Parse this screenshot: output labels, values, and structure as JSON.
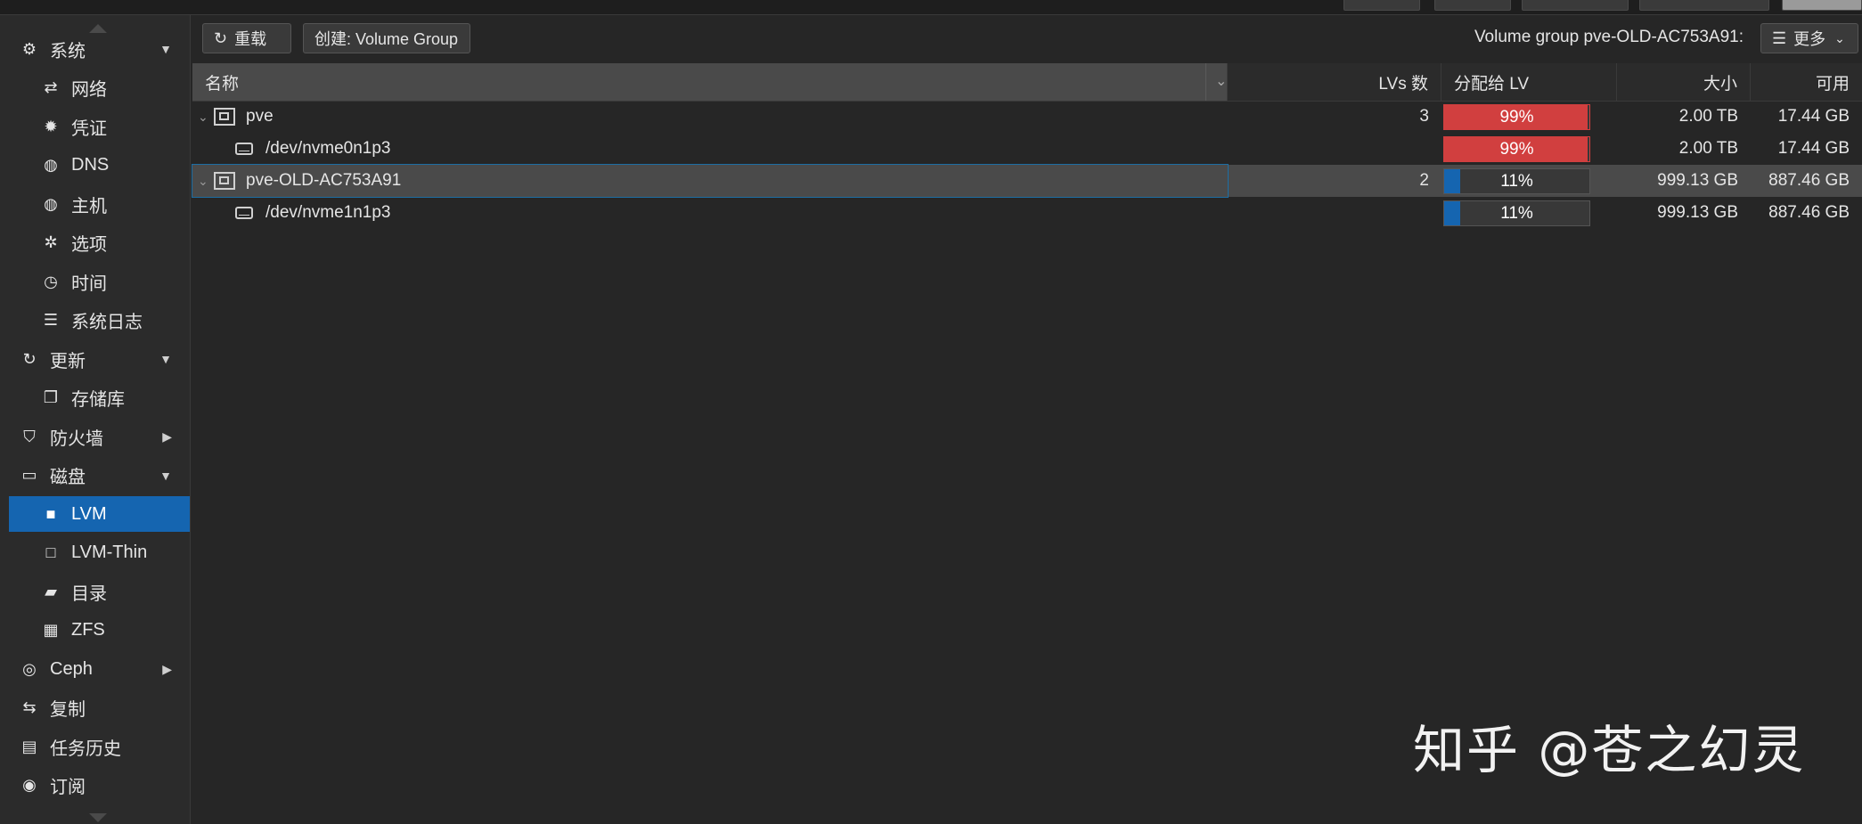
{
  "sidebar": {
    "items": [
      {
        "label": "系统",
        "icon": "gears-icon",
        "glyph": "⚙",
        "level": "top",
        "arrow": "▼"
      },
      {
        "label": "网络",
        "icon": "exchange-icon",
        "glyph": "⇄",
        "level": "sub"
      },
      {
        "label": "凭证",
        "icon": "certificate-icon",
        "glyph": "✹",
        "level": "sub"
      },
      {
        "label": "DNS",
        "icon": "globe-icon",
        "glyph": "◍",
        "level": "sub"
      },
      {
        "label": "主机",
        "icon": "globe-icon",
        "glyph": "◍",
        "level": "sub"
      },
      {
        "label": "选项",
        "icon": "gear-icon",
        "glyph": "✲",
        "level": "sub"
      },
      {
        "label": "时间",
        "icon": "clock-icon",
        "glyph": "◷",
        "level": "sub"
      },
      {
        "label": "系统日志",
        "icon": "list-icon",
        "glyph": "☰",
        "level": "sub"
      },
      {
        "label": "更新",
        "icon": "refresh-icon",
        "glyph": "↻",
        "level": "top",
        "arrow": "▼"
      },
      {
        "label": "存储库",
        "icon": "copy-icon",
        "glyph": "❐",
        "level": "sub"
      },
      {
        "label": "防火墙",
        "icon": "shield-icon",
        "glyph": "⛉",
        "level": "top",
        "arrow": "▶"
      },
      {
        "label": "磁盘",
        "icon": "hdd-icon",
        "glyph": "▭",
        "level": "top",
        "arrow": "▼"
      },
      {
        "label": "LVM",
        "icon": "square-icon",
        "glyph": "■",
        "level": "sub",
        "selected": true
      },
      {
        "label": "LVM-Thin",
        "icon": "square-outline-icon",
        "glyph": "□",
        "level": "sub"
      },
      {
        "label": "目录",
        "icon": "folder-icon",
        "glyph": "▰",
        "level": "sub"
      },
      {
        "label": "ZFS",
        "icon": "th-large-icon",
        "glyph": "▦",
        "level": "sub"
      },
      {
        "label": "Ceph",
        "icon": "ceph-icon",
        "glyph": "◎",
        "level": "top",
        "arrow": "▶"
      },
      {
        "label": "复制",
        "icon": "retweet-icon",
        "glyph": "⇆",
        "level": "top"
      },
      {
        "label": "任务历史",
        "icon": "list-alt-icon",
        "glyph": "▤",
        "level": "top"
      },
      {
        "label": "订阅",
        "icon": "support-icon",
        "glyph": "◉",
        "level": "top"
      }
    ]
  },
  "toolbar": {
    "reload_label": "重载",
    "create_label": "创建: Volume Group",
    "vg_label": "Volume group pve-OLD-AC753A91:",
    "more_label": "更多"
  },
  "grid": {
    "columns": {
      "name": "名称",
      "lvs": "LVs 数",
      "alloc": "分配给 LV",
      "size": "大小",
      "free": "可用"
    },
    "rows": [
      {
        "name": "pve",
        "type": "vg",
        "lvs": "3",
        "alloc_text": "99%",
        "alloc": 0.99,
        "alloc_color": "#d13f3f",
        "size": "2.00 TB",
        "free": "17.44 GB"
      },
      {
        "name": "/dev/nvme0n1p3",
        "type": "pv",
        "lvs": "",
        "alloc_text": "99%",
        "alloc": 0.99,
        "alloc_color": "#d13f3f",
        "size": "2.00 TB",
        "free": "17.44 GB"
      },
      {
        "name": "pve-OLD-AC753A91",
        "type": "vg",
        "lvs": "2",
        "alloc_text": "11%",
        "alloc": 0.11,
        "alloc_color": "#1565b0",
        "size": "999.13 GB",
        "free": "887.46 GB",
        "selected": true
      },
      {
        "name": "/dev/nvme1n1p3",
        "type": "pv",
        "lvs": "",
        "alloc_text": "11%",
        "alloc": 0.11,
        "alloc_color": "#1565b0",
        "size": "999.13 GB",
        "free": "887.46 GB"
      }
    ]
  },
  "watermark": "知乎 @苍之幻灵"
}
